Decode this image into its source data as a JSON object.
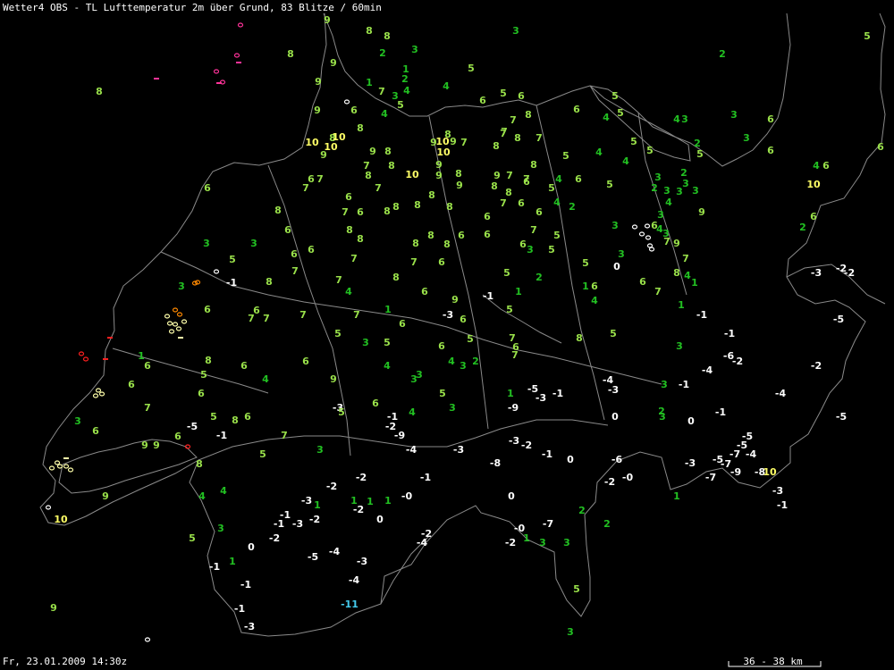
{
  "header": {
    "title": "Wetter4 OBS - TL Lufttemperatur 2m über Grund, 83 Blitze / 60min"
  },
  "footer": {
    "timestamp": "Fr, 23.01.2009 14:30z",
    "scale_label": "36 - 38 km"
  },
  "colors": {
    "background": "#000000",
    "border": "#8a8a8a",
    "warm_low": "#22c022",
    "warm_mid": "#99e04a",
    "warm_high": "#ffff66",
    "freezing": "#ffffff",
    "very_cold": "#44ccee",
    "lightning_old": "#ffffaa",
    "lightning_mid": "#ff8800",
    "lightning_new": "#ff2020",
    "lightning_pink": "#ff3399"
  },
  "observations": [
    [
      "9",
      366,
      22
    ],
    [
      "3",
      577,
      34
    ],
    [
      "8",
      413,
      34
    ],
    [
      "8",
      433,
      40
    ],
    [
      "2",
      428,
      59
    ],
    [
      "3",
      464,
      55
    ],
    [
      "8",
      325,
      60
    ],
    [
      "9",
      373,
      70
    ],
    [
      "1",
      454,
      77
    ],
    [
      "5",
      527,
      76
    ],
    [
      "2",
      808,
      60
    ],
    [
      "5",
      970,
      40
    ],
    [
      "8",
      111,
      102
    ],
    [
      "9",
      356,
      91
    ],
    [
      "1",
      413,
      92
    ],
    [
      "7",
      427,
      102
    ],
    [
      "3",
      442,
      107
    ],
    [
      "4",
      455,
      101
    ],
    [
      "4",
      499,
      96
    ],
    [
      "5",
      448,
      117
    ],
    [
      "2",
      453,
      88
    ],
    [
      "6",
      540,
      112
    ],
    [
      "5",
      563,
      104
    ],
    [
      "6",
      583,
      107
    ],
    [
      "5",
      688,
      107
    ],
    [
      "9",
      355,
      123
    ],
    [
      "6",
      396,
      123
    ],
    [
      "4",
      430,
      127
    ],
    [
      "8",
      403,
      143
    ],
    [
      "7",
      574,
      134
    ],
    [
      "7",
      564,
      147
    ],
    [
      "8",
      591,
      128
    ],
    [
      "6",
      645,
      122
    ],
    [
      "4",
      678,
      131
    ],
    [
      "5",
      694,
      126
    ],
    [
      "4",
      757,
      133
    ],
    [
      "3",
      766,
      133
    ],
    [
      "3",
      821,
      128
    ],
    [
      "6",
      862,
      133
    ],
    [
      "10",
      349,
      159
    ],
    [
      "9",
      362,
      173
    ],
    [
      "8",
      372,
      154
    ],
    [
      "10",
      379,
      153
    ],
    [
      "10",
      370,
      164
    ],
    [
      "9",
      485,
      159
    ],
    [
      "10",
      495,
      158
    ],
    [
      "8",
      501,
      150
    ],
    [
      "9",
      507,
      158
    ],
    [
      "7",
      519,
      159
    ],
    [
      "10",
      496,
      170
    ],
    [
      "8",
      555,
      163
    ],
    [
      "7",
      563,
      149
    ],
    [
      "8",
      579,
      154
    ],
    [
      "7",
      603,
      154
    ],
    [
      "2",
      780,
      160
    ],
    [
      "3",
      835,
      154
    ],
    [
      "6",
      862,
      168
    ],
    [
      "6",
      985,
      164
    ],
    [
      "5",
      709,
      158
    ],
    [
      "5",
      727,
      168
    ],
    [
      "9",
      417,
      169
    ],
    [
      "8",
      434,
      169
    ],
    [
      "4",
      670,
      170
    ],
    [
      "4",
      700,
      180
    ],
    [
      "5",
      633,
      174
    ],
    [
      "5",
      783,
      172
    ],
    [
      "7",
      358,
      200
    ],
    [
      "6",
      348,
      200
    ],
    [
      "7",
      410,
      185
    ],
    [
      "8",
      438,
      185
    ],
    [
      "8",
      412,
      196
    ],
    [
      "10",
      461,
      195
    ],
    [
      "9",
      491,
      184
    ],
    [
      "9",
      491,
      196
    ],
    [
      "8",
      513,
      194
    ],
    [
      "9",
      556,
      196
    ],
    [
      "7",
      570,
      196
    ],
    [
      "8",
      597,
      184
    ],
    [
      "7",
      589,
      200
    ],
    [
      "4",
      913,
      185
    ],
    [
      "6",
      924,
      185
    ],
    [
      "6",
      232,
      210
    ],
    [
      "7",
      342,
      210
    ],
    [
      "7",
      423,
      210
    ],
    [
      "8",
      483,
      218
    ],
    [
      "8",
      467,
      229
    ],
    [
      "9",
      514,
      207
    ],
    [
      "8",
      553,
      208
    ],
    [
      "8",
      569,
      215
    ],
    [
      "6",
      589,
      203
    ],
    [
      "5",
      617,
      210
    ],
    [
      "4",
      625,
      200
    ],
    [
      "6",
      647,
      200
    ],
    [
      "5",
      682,
      206
    ],
    [
      "3",
      736,
      198
    ],
    [
      "3",
      746,
      213
    ],
    [
      "2",
      732,
      210
    ],
    [
      "3",
      760,
      214
    ],
    [
      "3",
      767,
      205
    ],
    [
      "2",
      765,
      193
    ],
    [
      "3",
      778,
      213
    ],
    [
      "10",
      910,
      206
    ],
    [
      "8",
      311,
      235
    ],
    [
      "6",
      390,
      220
    ],
    [
      "7",
      386,
      237
    ],
    [
      "6",
      403,
      237
    ],
    [
      "8",
      433,
      236
    ],
    [
      "8",
      443,
      231
    ],
    [
      "8",
      503,
      231
    ],
    [
      "7",
      563,
      227
    ],
    [
      "6",
      583,
      227
    ],
    [
      "6",
      603,
      237
    ],
    [
      "2",
      640,
      231
    ],
    [
      "4",
      623,
      226
    ],
    [
      "6",
      545,
      242
    ],
    [
      "3",
      739,
      240
    ],
    [
      "4",
      748,
      226
    ],
    [
      "3",
      745,
      261
    ],
    [
      "9",
      785,
      237
    ],
    [
      "6",
      910,
      242
    ],
    [
      "3",
      231,
      272
    ],
    [
      "3",
      284,
      272
    ],
    [
      "6",
      322,
      257
    ],
    [
      "6",
      329,
      284
    ],
    [
      "6",
      348,
      279
    ],
    [
      "8",
      391,
      257
    ],
    [
      "8",
      403,
      267
    ],
    [
      "8",
      465,
      272
    ],
    [
      "8",
      482,
      263
    ],
    [
      "8",
      500,
      273
    ],
    [
      "6",
      516,
      263
    ],
    [
      "6",
      545,
      262
    ],
    [
      "6",
      585,
      273
    ],
    [
      "7",
      597,
      257
    ],
    [
      "5",
      623,
      263
    ],
    [
      "3",
      688,
      252
    ],
    [
      "6",
      732,
      252
    ],
    [
      "4",
      738,
      256
    ],
    [
      "7",
      746,
      270
    ],
    [
      "9",
      757,
      272
    ],
    [
      "2",
      898,
      254
    ],
    [
      "5",
      260,
      290
    ],
    [
      "7",
      330,
      303
    ],
    [
      "7",
      396,
      289
    ],
    [
      "7",
      463,
      293
    ],
    [
      "6",
      494,
      293
    ],
    [
      "3",
      593,
      279
    ],
    [
      "5",
      617,
      279
    ],
    [
      "5",
      655,
      294
    ],
    [
      "0",
      690,
      298
    ],
    [
      "3",
      695,
      284
    ],
    [
      "7",
      767,
      289
    ],
    [
      "4",
      769,
      308
    ],
    [
      "8",
      757,
      305
    ],
    [
      "-3",
      913,
      305
    ],
    [
      "-2",
      941,
      300
    ],
    [
      "-2",
      950,
      305
    ],
    [
      "3",
      203,
      320
    ],
    [
      "-1",
      259,
      316
    ],
    [
      "8",
      301,
      315
    ],
    [
      "7",
      379,
      313
    ],
    [
      "4",
      390,
      326
    ],
    [
      "8",
      443,
      310
    ],
    [
      "6",
      475,
      326
    ],
    [
      "9",
      509,
      335
    ],
    [
      "-1",
      546,
      331
    ],
    [
      "1",
      580,
      326
    ],
    [
      "5",
      567,
      305
    ],
    [
      "2",
      603,
      310
    ],
    [
      "1",
      655,
      320
    ],
    [
      "6",
      665,
      320
    ],
    [
      "6",
      719,
      315
    ],
    [
      "7",
      736,
      326
    ],
    [
      "1",
      777,
      316
    ],
    [
      "6",
      232,
      346
    ],
    [
      "7",
      281,
      356
    ],
    [
      "6",
      287,
      347
    ],
    [
      "7",
      298,
      356
    ],
    [
      "7",
      339,
      352
    ],
    [
      "7",
      399,
      352
    ],
    [
      "1",
      434,
      346
    ],
    [
      "6",
      450,
      362
    ],
    [
      "-3",
      501,
      352
    ],
    [
      "6",
      518,
      357
    ],
    [
      "5",
      570,
      346
    ],
    [
      "4",
      665,
      336
    ],
    [
      "1",
      762,
      341
    ],
    [
      "-1",
      785,
      352
    ],
    [
      "-5",
      938,
      357
    ],
    [
      "5",
      378,
      373
    ],
    [
      "3",
      409,
      383
    ],
    [
      "5",
      433,
      383
    ],
    [
      "6",
      494,
      387
    ],
    [
      "5",
      526,
      379
    ],
    [
      "7",
      573,
      378
    ],
    [
      "6",
      577,
      388
    ],
    [
      "7",
      576,
      397
    ],
    [
      "8",
      648,
      378
    ],
    [
      "5",
      686,
      373
    ],
    [
      "-1",
      816,
      373
    ],
    [
      "3",
      760,
      387
    ],
    [
      "1",
      158,
      398
    ],
    [
      "6",
      165,
      409
    ],
    [
      "8",
      233,
      403
    ],
    [
      "6",
      273,
      409
    ],
    [
      "6",
      342,
      404
    ],
    [
      "4",
      433,
      409
    ],
    [
      "4",
      505,
      404
    ],
    [
      "3",
      518,
      409
    ],
    [
      "2",
      532,
      404
    ],
    [
      "-6",
      815,
      398
    ],
    [
      "-2",
      825,
      404
    ],
    [
      "-4",
      791,
      414
    ],
    [
      "-2",
      913,
      409
    ],
    [
      "6",
      147,
      430
    ],
    [
      "6",
      225,
      440
    ],
    [
      "5",
      228,
      419
    ],
    [
      "4",
      297,
      424
    ],
    [
      "9",
      373,
      424
    ],
    [
      "3",
      463,
      424
    ],
    [
      "3",
      469,
      419
    ],
    [
      "5",
      495,
      440
    ],
    [
      "1",
      571,
      440
    ],
    [
      "-5",
      596,
      435
    ],
    [
      "-3",
      605,
      445
    ],
    [
      "-1",
      624,
      440
    ],
    [
      "-4",
      680,
      425
    ],
    [
      "-3",
      686,
      436
    ],
    [
      "3",
      743,
      430
    ],
    [
      "-1",
      765,
      430
    ],
    [
      "-4",
      873,
      440
    ],
    [
      "7",
      165,
      456
    ],
    [
      "5",
      239,
      466
    ],
    [
      "8",
      263,
      470
    ],
    [
      "6",
      277,
      466
    ],
    [
      "-3",
      378,
      456
    ],
    [
      "5",
      382,
      461
    ],
    [
      "6",
      420,
      451
    ],
    [
      "-1",
      439,
      466
    ],
    [
      "4",
      461,
      461
    ],
    [
      "3",
      506,
      456
    ],
    [
      "-9",
      574,
      456
    ],
    [
      "0",
      688,
      466
    ],
    [
      "2",
      740,
      460
    ],
    [
      "3",
      741,
      466
    ],
    [
      "0",
      773,
      471
    ],
    [
      "-1",
      806,
      461
    ],
    [
      "-5",
      941,
      466
    ],
    [
      "3",
      87,
      471
    ],
    [
      "6",
      107,
      482
    ],
    [
      "-5",
      215,
      477
    ],
    [
      "-1",
      248,
      487
    ],
    [
      "7",
      318,
      487
    ],
    [
      "-2",
      437,
      477
    ],
    [
      "-9",
      447,
      487
    ],
    [
      "9",
      162,
      498
    ],
    [
      "9",
      175,
      498
    ],
    [
      "6",
      199,
      488
    ],
    [
      "3",
      358,
      503
    ],
    [
      "-4",
      460,
      503
    ],
    [
      "-3",
      513,
      503
    ],
    [
      "-3",
      575,
      493
    ],
    [
      "-2",
      589,
      498
    ],
    [
      "-1",
      612,
      508
    ],
    [
      "0",
      638,
      514
    ],
    [
      "-5",
      830,
      498
    ],
    [
      "-5",
      836,
      488
    ],
    [
      "-7",
      822,
      508
    ],
    [
      "-4",
      840,
      508
    ],
    [
      "8",
      223,
      519
    ],
    [
      "5",
      294,
      508
    ],
    [
      "-2",
      404,
      534
    ],
    [
      "-1",
      476,
      534
    ],
    [
      "-8",
      554,
      518
    ],
    [
      "-6",
      690,
      514
    ],
    [
      "-3",
      772,
      518
    ],
    [
      "-5",
      803,
      514
    ],
    [
      "-7",
      812,
      519
    ],
    [
      "-9",
      823,
      528
    ],
    [
      "-8",
      850,
      528
    ],
    [
      "10",
      861,
      528
    ],
    [
      "-7",
      795,
      534
    ],
    [
      "4",
      226,
      555
    ],
    [
      "4",
      250,
      549
    ],
    [
      "-2",
      371,
      544
    ],
    [
      "1",
      396,
      560
    ],
    [
      "1",
      414,
      561
    ],
    [
      "1",
      434,
      560
    ],
    [
      "-0",
      455,
      555
    ],
    [
      "-2",
      682,
      539
    ],
    [
      "-0",
      702,
      534
    ],
    [
      "-3",
      870,
      549
    ],
    [
      "9",
      118,
      555
    ],
    [
      "0",
      572,
      555
    ],
    [
      "1",
      757,
      555
    ],
    [
      "-3",
      343,
      560
    ],
    [
      "1",
      355,
      565
    ],
    [
      "-2",
      401,
      570
    ],
    [
      "0",
      425,
      581
    ],
    [
      "-1",
      319,
      576
    ],
    [
      "-1",
      312,
      586
    ],
    [
      "-3",
      333,
      586
    ],
    [
      "-2",
      352,
      581
    ],
    [
      "2",
      651,
      571
    ],
    [
      "2",
      679,
      586
    ],
    [
      "-1",
      875,
      565
    ],
    [
      "10",
      68,
      581
    ],
    [
      "3",
      247,
      591
    ],
    [
      "-2",
      477,
      597
    ],
    [
      "-4",
      472,
      607
    ],
    [
      "-0",
      581,
      591
    ],
    [
      "-7",
      613,
      586
    ],
    [
      "-2",
      571,
      607
    ],
    [
      "1",
      589,
      602
    ],
    [
      "3",
      607,
      607
    ],
    [
      "3",
      634,
      607
    ],
    [
      "5",
      215,
      602
    ],
    [
      "0",
      281,
      612
    ],
    [
      "-2",
      307,
      602
    ],
    [
      "-5",
      350,
      623
    ],
    [
      "-4",
      374,
      617
    ],
    [
      "-3",
      405,
      628
    ],
    [
      "-1",
      240,
      634
    ],
    [
      "1",
      260,
      628
    ],
    [
      "-1",
      275,
      654
    ],
    [
      "-4",
      396,
      649
    ],
    [
      "5",
      645,
      659
    ],
    [
      "-1",
      268,
      681
    ],
    [
      "-11",
      391,
      676
    ],
    [
      "9",
      60,
      680
    ],
    [
      "-3",
      279,
      701
    ],
    [
      "3",
      638,
      707
    ]
  ],
  "lightning": [
    [
      "o",
      269,
      28,
      "pink"
    ],
    [
      "o",
      265,
      62,
      "pink"
    ],
    [
      "=",
      267,
      70,
      "pink"
    ],
    [
      "=",
      175,
      88,
      "pink"
    ],
    [
      "o",
      242,
      80,
      "pink"
    ],
    [
      "=",
      245,
      93,
      "pink"
    ],
    [
      "o",
      249,
      92,
      "pink"
    ],
    [
      "o",
      388,
      114,
      "white"
    ],
    [
      "o",
      242,
      304,
      "white"
    ],
    [
      "o",
      710,
      254,
      "white"
    ],
    [
      "o",
      724,
      253,
      "white"
    ],
    [
      "o",
      718,
      262,
      "white"
    ],
    [
      "o",
      725,
      266,
      "white"
    ],
    [
      "o",
      727,
      275,
      "white"
    ],
    [
      "o",
      729,
      279,
      "white"
    ],
    [
      "o",
      165,
      716,
      "white"
    ],
    [
      "o",
      54,
      568,
      "white"
    ],
    [
      "o",
      218,
      317,
      "orange"
    ],
    [
      "o",
      221,
      316,
      "orange"
    ],
    [
      "o",
      196,
      347,
      "orange"
    ],
    [
      "o",
      201,
      352,
      "orange"
    ],
    [
      "o",
      187,
      354,
      "lt"
    ],
    [
      "o",
      190,
      362,
      "lt"
    ],
    [
      "o",
      196,
      363,
      "lt"
    ],
    [
      "o",
      200,
      368,
      "lt"
    ],
    [
      "o",
      206,
      360,
      "lt"
    ],
    [
      "o",
      192,
      371,
      "lt"
    ],
    [
      "=",
      202,
      378,
      "lt"
    ],
    [
      "o",
      110,
      437,
      "lt"
    ],
    [
      "o",
      114,
      441,
      "lt"
    ],
    [
      "o",
      107,
      443,
      "lt"
    ],
    [
      "=",
      74,
      513,
      "lt"
    ],
    [
      "o",
      64,
      518,
      "lt"
    ],
    [
      "o",
      67,
      522,
      "lt"
    ],
    [
      "o",
      74,
      522,
      "lt"
    ],
    [
      "o",
      79,
      526,
      "lt"
    ],
    [
      "o",
      58,
      524,
      "lt"
    ],
    [
      "=",
      123,
      378,
      "red"
    ],
    [
      "o",
      91,
      396,
      "red"
    ],
    [
      "o",
      96,
      402,
      "red"
    ],
    [
      "=",
      118,
      402,
      "red"
    ],
    [
      "o",
      210,
      500,
      "red"
    ]
  ]
}
